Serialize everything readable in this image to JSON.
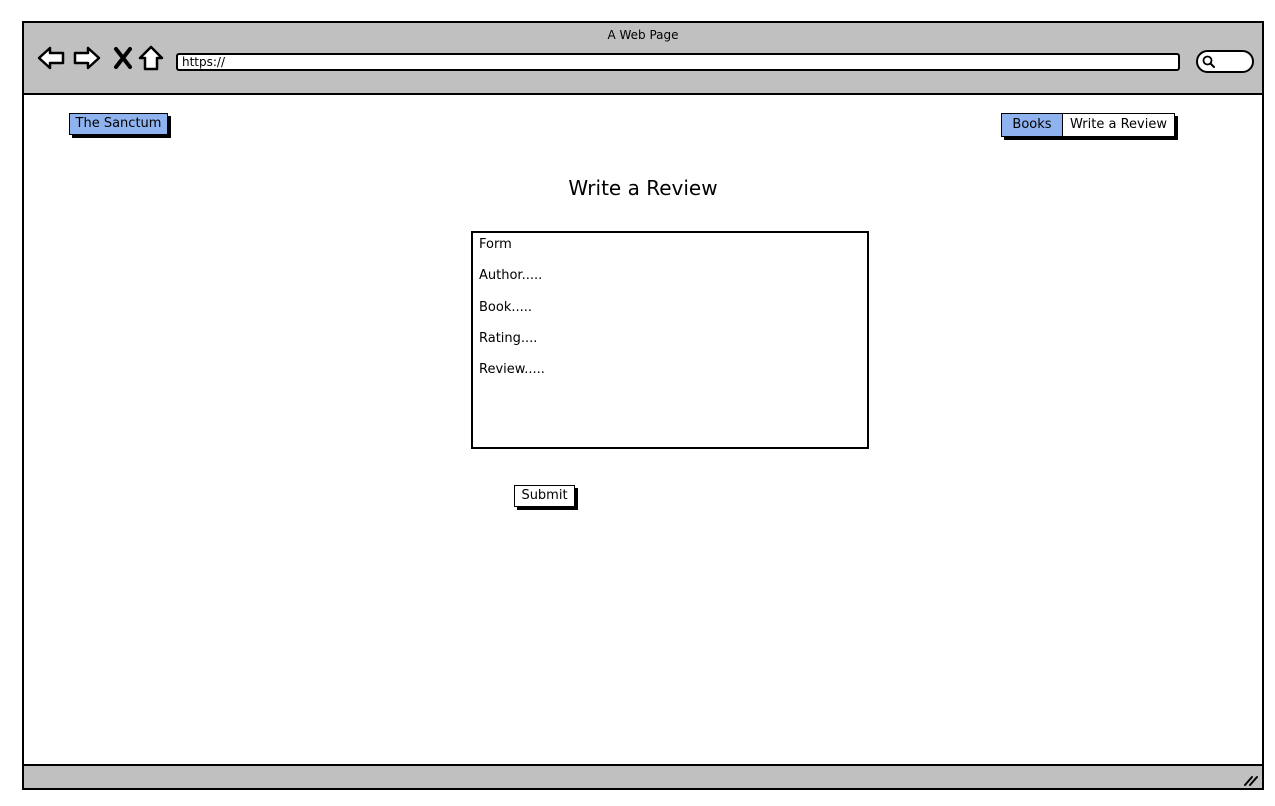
{
  "window": {
    "title": "A Web Page",
    "url": "https://"
  },
  "icons": {
    "back": "arrow-left-icon",
    "forward": "arrow-right-icon",
    "stop": "close-x-icon",
    "home": "home-icon",
    "search": "search-icon",
    "resize": "resize-grip-icon"
  },
  "colors": {
    "chrome": "#c0c0c0",
    "accent": "#8fb3ee"
  },
  "nav": {
    "brand": "The Sanctum",
    "tabs": [
      {
        "label": "Books",
        "active": true
      },
      {
        "label": "Write a Review",
        "active": false
      }
    ]
  },
  "main": {
    "heading": "Write a Review",
    "form": {
      "title": "Form",
      "fields": [
        "Author.....",
        "Book.....",
        "Rating....",
        "Review....."
      ]
    },
    "submit_label": "Submit"
  }
}
